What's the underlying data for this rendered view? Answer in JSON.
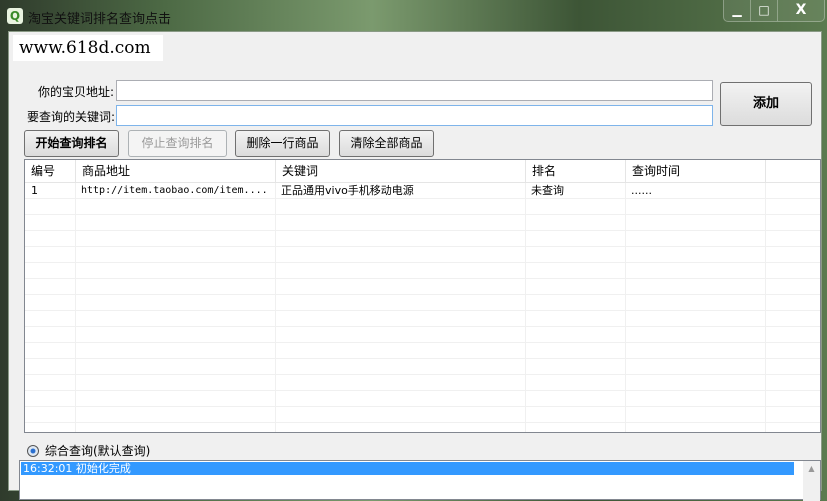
{
  "window": {
    "title": "淘宝关键词排名查询点击",
    "minimize": "▁",
    "maximize": "□",
    "close": "X",
    "icon": "magnifier-icon"
  },
  "logo": "www.618d.com",
  "form": {
    "url_label": "你的宝贝地址:",
    "keyword_label": "要查询的关键词:",
    "url_value": "",
    "keyword_value": "",
    "add_label": "添加"
  },
  "toolbar": {
    "start": "开始查询排名",
    "stop": "停止查询排名",
    "delete_row": "删除一行商品",
    "clear_all": "清除全部商品"
  },
  "table": {
    "columns": [
      "编号",
      "商品地址",
      "关键词",
      "排名",
      "查询时间"
    ],
    "rows": [
      {
        "id": "1",
        "url": "http://item.taobao.com/item....",
        "keyword": "正品通用vivo手机移动电源",
        "rank": "未查询",
        "time": "......"
      }
    ]
  },
  "radio": {
    "label": "综合查询(默认查询)",
    "checked": true
  },
  "log": {
    "lines": [
      "16:32:01 初始化完成"
    ]
  }
}
